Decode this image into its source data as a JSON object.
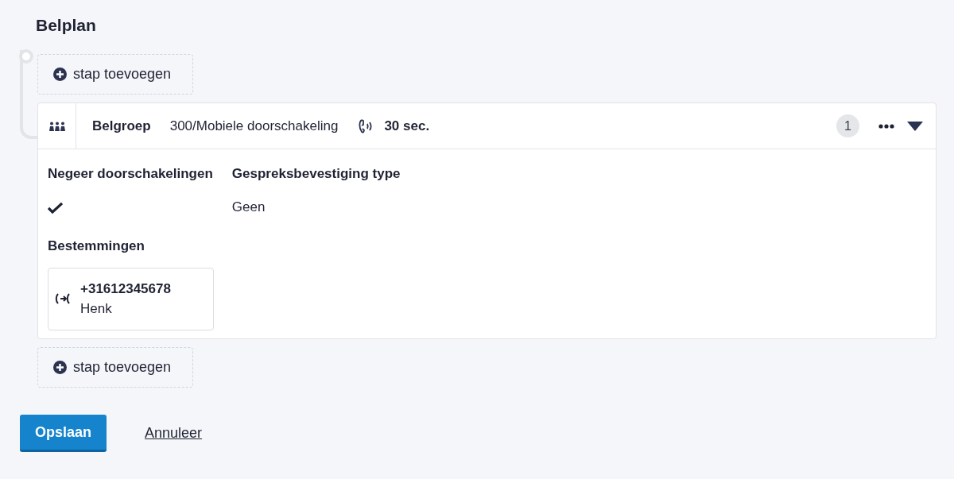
{
  "title": "Belplan",
  "steps": [
    {
      "kind": "add",
      "label": "stap toevoegen"
    },
    {
      "kind": "group",
      "name": "Belgroep",
      "target": "300/Mobiele doorschakeling",
      "timeout": "30 sec.",
      "count": "1",
      "expanded": true,
      "fields": [
        {
          "kind": "check",
          "label": "Negeer doorschakelingen",
          "checked": true
        },
        {
          "kind": "text",
          "label": "Gespreksbevestiging type",
          "value": "Geen"
        }
      ],
      "destinations_label": "Bestemmingen",
      "destinations": [
        {
          "number": "+31612345678",
          "name": "Henk"
        }
      ]
    },
    {
      "kind": "add",
      "label": "stap toevoegen"
    }
  ],
  "save_label": "Opslaan",
  "cancel_label": "Annuleer"
}
